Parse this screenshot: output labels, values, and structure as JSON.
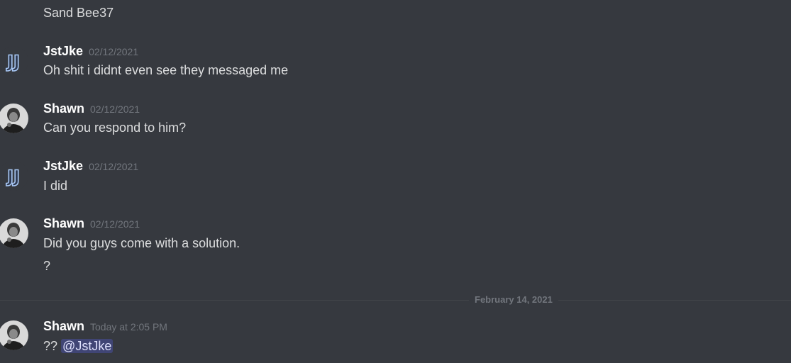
{
  "messages": [
    {
      "text": "Sand Bee37"
    },
    {
      "username": "JstJke",
      "timestamp": "02/12/2021",
      "text": "Oh shit i didnt even see they messaged me"
    },
    {
      "username": "Shawn",
      "timestamp": "02/12/2021",
      "text": "Can you respond to him?"
    },
    {
      "username": "JstJke",
      "timestamp": "02/12/2021",
      "text": "I did"
    },
    {
      "username": "Shawn",
      "timestamp": "02/12/2021",
      "text": "Did you guys come with a solution.",
      "text2": "?"
    },
    {
      "username": "Shawn",
      "timestamp": "Today at 2:05 PM",
      "text": "??",
      "mention": "@JstJke"
    }
  ],
  "divider": {
    "label": "February 14, 2021"
  },
  "colors": {
    "background": "#36393f",
    "username": "#ffffff",
    "message_text": "#dcddde",
    "timestamp": "#72767d",
    "mention": "#dee0fc"
  },
  "icons": {
    "jstjke_avatar": "jj-logo-avatar-icon",
    "shawn_avatar": "person-photo-avatar-icon"
  }
}
